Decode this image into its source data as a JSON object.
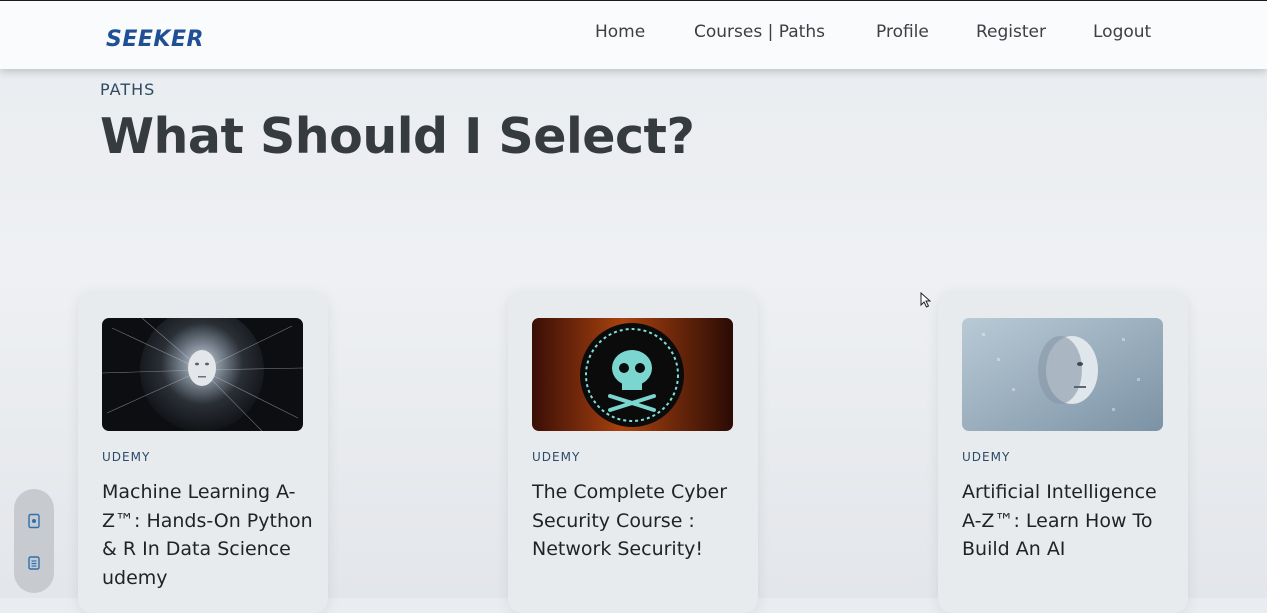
{
  "nav": {
    "logo": "SEEKER",
    "links": [
      "Home",
      "Courses | Paths",
      "Profile",
      "Register",
      "Logout"
    ]
  },
  "header": {
    "eyebrow": "PATHS",
    "title": "What Should I Select?"
  },
  "courses": [
    {
      "provider": "UDEMY",
      "title": "Machine Learning A-Z™: Hands-On Python & R In Data Science udemy",
      "thumbnail_icon": "ai-face-particles-image"
    },
    {
      "provider": "UDEMY",
      "title": "The Complete Cyber Security Course : Network Security!",
      "thumbnail_icon": "skull-binary-image"
    },
    {
      "provider": "UDEMY",
      "title": "Artificial Intelligence A-Z™: Learn How To Build An AI",
      "thumbnail_icon": "ai-head-dissolving-image"
    }
  ],
  "side_widget": {
    "icons": [
      "document-icon",
      "notepad-icon"
    ]
  },
  "colors": {
    "brand": "#1f4f95",
    "eyebrow": "#2e4a66",
    "title": "#363b40"
  }
}
